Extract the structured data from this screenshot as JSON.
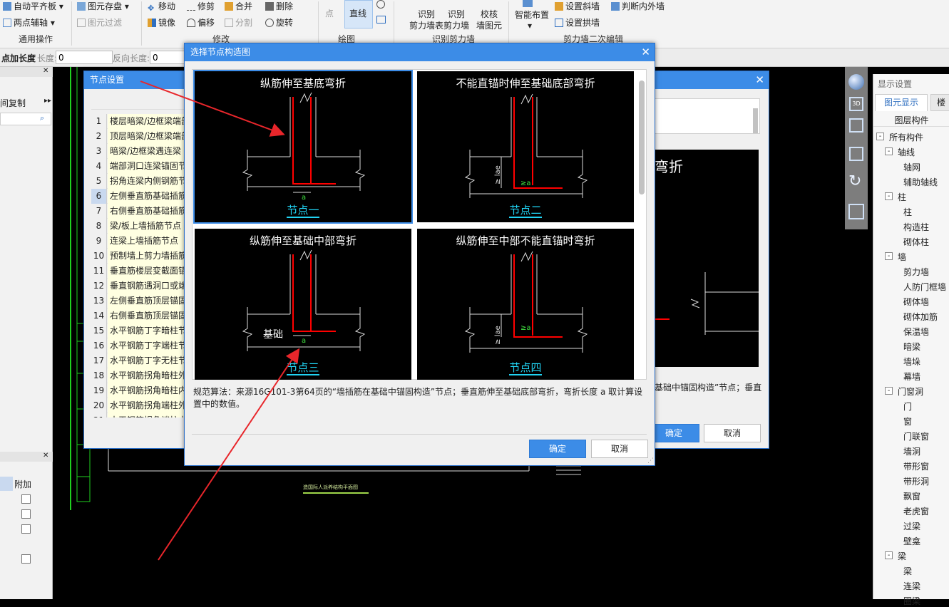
{
  "ribbon": {
    "auto_align": "自动平齐板",
    "two_point_axis": "两点辅轴",
    "general_ops": "通用操作",
    "elem_save": "图元存盘",
    "elem_filter": "图元过滤",
    "move": "移动",
    "trim": "修剪",
    "merge": "合并",
    "delete": "删除",
    "mirror": "镜像",
    "offset": "偏移",
    "split": "分割",
    "rotate": "旋转",
    "modify": "修改",
    "point": "点",
    "line": "直线",
    "draw": "绘图",
    "identify_wall_table_1": "识别",
    "identify_wall_table_2": "剪力墙表",
    "identify_wall_1": "识别",
    "identify_wall_2": "剪力墙",
    "check_wall_1": "校核",
    "check_wall_2": "墙图元",
    "identify_group": "识别剪力墙",
    "smart_layout": "智能布置",
    "set_slope_wall": "设置斜墙",
    "set_arch_wall": "设置拱墙",
    "judge_in_out": "判断内外墙",
    "wall_edit_group": "剪力墙二次编辑"
  },
  "optbar": {
    "point_add_len": "点加长度",
    "len_label": "长度:",
    "len_value": "0",
    "reverse_len_label": "反向长度:",
    "reverse_len_value": "0"
  },
  "left_panel": {
    "layer_copy": "间复制",
    "attach_header": "附加"
  },
  "right_panel": {
    "title": "显示设置",
    "tab_elem_display": "图元显示",
    "tab_floor": "楼",
    "tree_header": "图层构件",
    "items": [
      {
        "label": "所有构件",
        "level": 0,
        "box": "-"
      },
      {
        "label": "轴线",
        "level": 1,
        "box": "-"
      },
      {
        "label": "轴网",
        "level": 2
      },
      {
        "label": "辅助轴线",
        "level": 2
      },
      {
        "label": "柱",
        "level": 1,
        "box": "-"
      },
      {
        "label": "柱",
        "level": 2
      },
      {
        "label": "构造柱",
        "level": 2
      },
      {
        "label": "砌体柱",
        "level": 2
      },
      {
        "label": "墙",
        "level": 1,
        "box": "-"
      },
      {
        "label": "剪力墙",
        "level": 2
      },
      {
        "label": "人防门框墙",
        "level": 2
      },
      {
        "label": "砌体墙",
        "level": 2
      },
      {
        "label": "砌体加筋",
        "level": 2
      },
      {
        "label": "保温墙",
        "level": 2
      },
      {
        "label": "暗梁",
        "level": 2
      },
      {
        "label": "墙垛",
        "level": 2
      },
      {
        "label": "幕墙",
        "level": 2
      },
      {
        "label": "门窗洞",
        "level": 1,
        "box": "-"
      },
      {
        "label": "门",
        "level": 2
      },
      {
        "label": "窗",
        "level": 2
      },
      {
        "label": "门联窗",
        "level": 2
      },
      {
        "label": "墙洞",
        "level": 2
      },
      {
        "label": "带形窗",
        "level": 2
      },
      {
        "label": "带形洞",
        "level": 2
      },
      {
        "label": "飘窗",
        "level": 2
      },
      {
        "label": "老虎窗",
        "level": 2
      },
      {
        "label": "过梁",
        "level": 2
      },
      {
        "label": "壁龛",
        "level": 2
      },
      {
        "label": "梁",
        "level": 1,
        "box": "-"
      },
      {
        "label": "梁",
        "level": 2
      },
      {
        "label": "连梁",
        "level": 2
      },
      {
        "label": "圈梁",
        "level": 2
      }
    ]
  },
  "canvas": {
    "drawing_caption": "造国际人派养结构平面图"
  },
  "node_settings_dialog": {
    "title": "节点设置",
    "rows": [
      {
        "num": "1",
        "text": "楼层暗梁/边框梁端部"
      },
      {
        "num": "2",
        "text": "顶层暗梁/边框梁端部"
      },
      {
        "num": "3",
        "text": "暗梁/边框梁遇连梁"
      },
      {
        "num": "4",
        "text": "端部洞口连梁锚固节点"
      },
      {
        "num": "5",
        "text": "拐角连梁内侧钢筋节点"
      },
      {
        "num": "6",
        "text": "左侧垂直筋基础插筋"
      },
      {
        "num": "7",
        "text": "右侧垂直筋基础插筋"
      },
      {
        "num": "8",
        "text": "梁/板上墙插筋节点"
      },
      {
        "num": "9",
        "text": "连梁上墙插筋节点"
      },
      {
        "num": "10",
        "text": "预制墙上剪力墙插筋"
      },
      {
        "num": "11",
        "text": "垂直筋楼层变截面锚固"
      },
      {
        "num": "12",
        "text": "垂直钢筋遇洞口或端部"
      },
      {
        "num": "13",
        "text": "左侧垂直筋顶层锚固"
      },
      {
        "num": "14",
        "text": "右侧垂直筋顶层锚固"
      },
      {
        "num": "15",
        "text": "水平钢筋丁字暗柱节点"
      },
      {
        "num": "16",
        "text": "水平钢筋丁字端柱节点"
      },
      {
        "num": "17",
        "text": "水平钢筋丁字无柱节点"
      },
      {
        "num": "18",
        "text": "水平钢筋拐角暗柱外侧"
      },
      {
        "num": "19",
        "text": "水平钢筋拐角暗柱内侧"
      },
      {
        "num": "20",
        "text": "水平钢筋拐角端柱外侧"
      },
      {
        "num": "21",
        "text": "水平钢筋拐角端柱内侧"
      }
    ],
    "preview_text": "弯折",
    "desc_tail": "基础中锚固构造”节点；垂直筋至基础底部弯折，弯折长度 a 取计算设置中的数值。",
    "ok": "确定",
    "cancel": "取消"
  },
  "node_diagram_dialog": {
    "title": "选择节点构造图",
    "nodes": [
      {
        "title": "纵筋伸至基底弯折",
        "label": "节点一"
      },
      {
        "title": "不能直锚时伸至基础底部弯折",
        "label": "节点二"
      },
      {
        "title": "纵筋伸至基础中部弯折",
        "label": "节点三"
      },
      {
        "title": "纵筋伸至中部不能直锚时弯折",
        "label": "节点四"
      }
    ],
    "dim_a": "a",
    "dim_ge_a": "≥a",
    "dim_lae": "≥ lae",
    "foundation_label": "基础",
    "description": "规范算法：来源16G101-3第64页的“墙插筋在基础中锚固构造”节点；垂直筋伸至基础底部弯折，弯折长度 a 取计算设置中的数值。",
    "ok": "确定",
    "cancel": "取消"
  },
  "colors": {
    "accent": "#3c8ce7",
    "rebar": "#ff0000",
    "annotation_arrow": "#e8262b",
    "dim_text": "#3fe03f",
    "node_label": "#21d3f3"
  }
}
